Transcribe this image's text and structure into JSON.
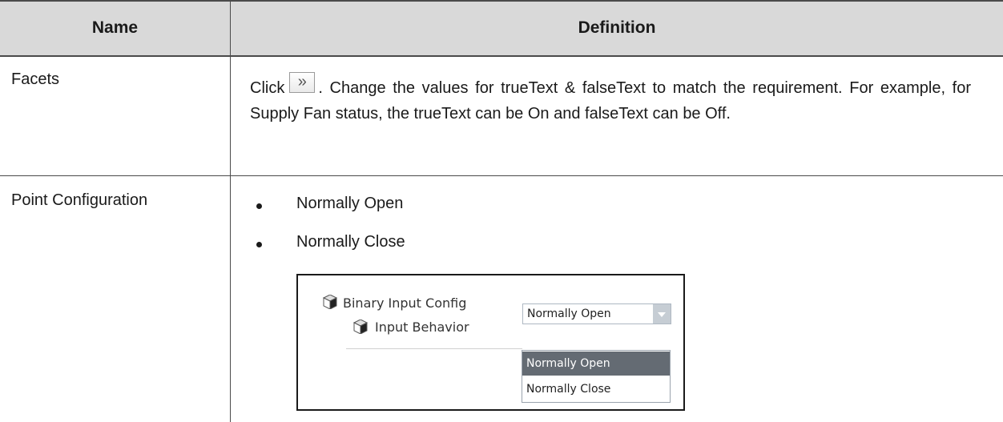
{
  "table": {
    "headers": [
      "Name",
      "Definition"
    ],
    "rows": [
      {
        "name": "Facets",
        "definition": {
          "prefix": "Click",
          "button_icon": "double-chevron-right-icon",
          "button_glyph": "»",
          "text": ". Change the values for trueText & falseText to match the requirement. For example, for Supply Fan status, the trueText can be On and falseText can be Off."
        }
      },
      {
        "name": "Point Configuration",
        "bullets": [
          "Normally Open",
          "Normally Close"
        ],
        "screenshot": {
          "group_label": "Binary Input Config",
          "property_label": "Input Behavior",
          "selected_value": "Normally Open",
          "options": [
            "Normally Open",
            "Normally Close"
          ],
          "highlighted_option": "Normally Open"
        }
      }
    ]
  }
}
